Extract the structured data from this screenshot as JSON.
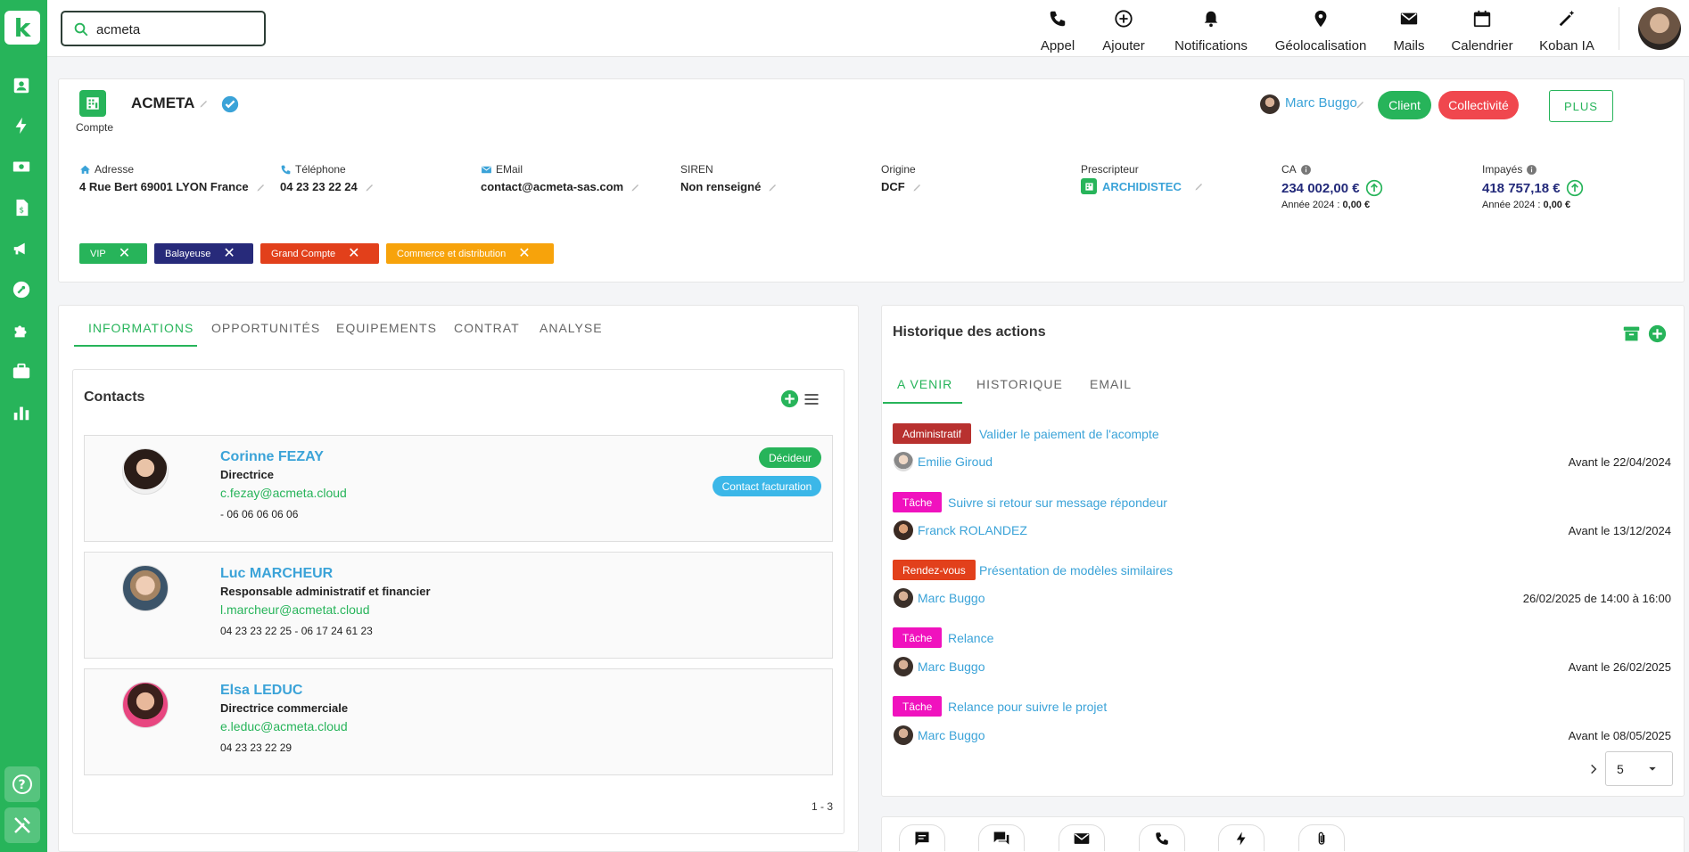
{
  "search": {
    "value": "acmeta"
  },
  "nav": [
    {
      "label": "Appel",
      "icon": "phone-icon"
    },
    {
      "label": "Ajouter",
      "icon": "plus-circle-icon"
    },
    {
      "label": "Notifications",
      "icon": "bell-icon"
    },
    {
      "label": "Géolocalisation",
      "icon": "map-pin-icon"
    },
    {
      "label": "Mails",
      "icon": "mail-icon"
    },
    {
      "label": "Calendrier",
      "icon": "calendar-icon"
    },
    {
      "label": "Koban IA",
      "icon": "magic-wand-icon"
    }
  ],
  "account": {
    "name": "ACMETA",
    "type_label": "Compte",
    "owner": "Marc Buggo",
    "status_pills": [
      "Client",
      "Collectivité"
    ],
    "plus_label": "PLUS",
    "fields": {
      "address": {
        "label": "Adresse",
        "value": "4 Rue Bert 69001 LYON France"
      },
      "phone": {
        "label": "Téléphone",
        "value": "04 23 23 22 24"
      },
      "email": {
        "label": "EMail",
        "value": "contact@acmeta-sas.com"
      },
      "siren": {
        "label": "SIREN",
        "value": "Non renseigné"
      },
      "origin": {
        "label": "Origine",
        "value": "DCF"
      },
      "prescripteur": {
        "label": "Prescripteur",
        "value": "ARCHIDISTEC"
      },
      "ca": {
        "label": "CA",
        "value": "234 002,00 €",
        "year_label": "Année 2024 :",
        "year_value": "0,00 €"
      },
      "impayes": {
        "label": "Impayés",
        "value": "418 757,18 €",
        "year_label": "Année 2024 :",
        "year_value": "0,00 €"
      }
    },
    "tags": [
      {
        "label": "VIP",
        "color": "#27b45a"
      },
      {
        "label": "Balayeuse",
        "color": "#272a7a"
      },
      {
        "label": "Grand Compte",
        "color": "#e2401b"
      },
      {
        "label": "Commerce et distribution",
        "color": "#f7a30b"
      }
    ]
  },
  "tabs": [
    "INFORMATIONS",
    "OPPORTUNITÉS",
    "EQUIPEMENTS",
    "CONTRAT",
    "ANALYSE"
  ],
  "contacts": {
    "title": "Contacts",
    "pagination": "1 - 3",
    "items": [
      {
        "name": "Corinne FEZAY",
        "role": "Directrice",
        "email": "c.fezay@acmeta.cloud",
        "phone": "- 06 06 06 06 06",
        "badges": [
          "Décideur",
          "Contact facturation"
        ]
      },
      {
        "name": "Luc MARCHEUR",
        "role": "Responsable administratif et financier",
        "email": "l.marcheur@acmetat.cloud",
        "phone": "04 23 23 22 25 - 06 17 24 61 23",
        "badges": []
      },
      {
        "name": "Elsa LEDUC",
        "role": "Directrice commerciale",
        "email": "e.leduc@acmeta.cloud",
        "phone": "04 23 23 22 29",
        "badges": []
      }
    ]
  },
  "history": {
    "title": "Historique des actions",
    "tabs": [
      "A VENIR",
      "HISTORIQUE",
      "EMAIL"
    ],
    "page_size": "5",
    "actions": [
      {
        "type": "Administratif",
        "color": "#b8312f",
        "title": "Valider le paiement de l'acompte",
        "user": "Emilie Giroud",
        "date": "Avant le 22/04/2024"
      },
      {
        "type": "Tâche",
        "color": "#f012be",
        "title": "Suivre si retour sur message répondeur",
        "user": "Franck ROLANDEZ",
        "date": "Avant le 13/12/2024"
      },
      {
        "type": "Rendez-vous",
        "color": "#e2401b",
        "title": "Présentation de modèles similaires",
        "user": "Marc Buggo",
        "date": "26/02/2025 de 14:00 à 16:00"
      },
      {
        "type": "Tâche",
        "color": "#f012be",
        "title": "Relance",
        "user": "Marc Buggo",
        "date": "Avant le 26/02/2025"
      },
      {
        "type": "Tâche",
        "color": "#f012be",
        "title": "Relance pour suivre le projet",
        "user": "Marc Buggo",
        "date": "Avant le 08/05/2025"
      }
    ]
  },
  "bottom_actions": [
    "note-icon",
    "chat-icon",
    "mail-icon",
    "phone-icon",
    "bolt-icon",
    "paperclip-icon"
  ]
}
